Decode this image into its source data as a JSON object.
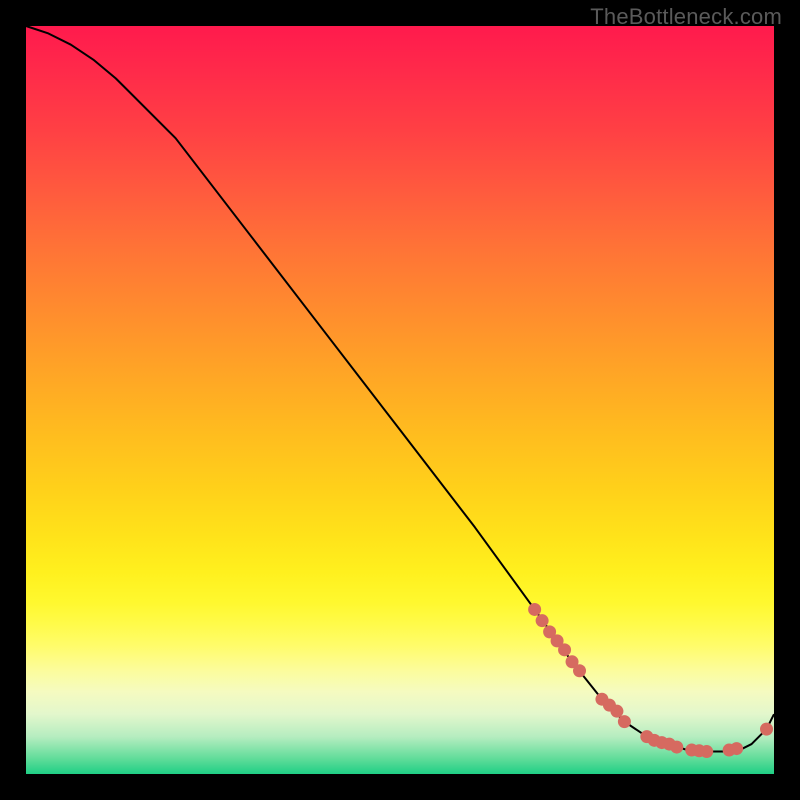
{
  "watermark": "TheBottleneck.com",
  "chart_data": {
    "type": "line",
    "title": "",
    "xlabel": "",
    "ylabel": "",
    "xlim": [
      0,
      100
    ],
    "ylim": [
      0,
      100
    ],
    "background_gradient": {
      "top_color": "#ff1a4d",
      "mid_color": "#ffd11a",
      "bottom_color": "#1fcf85"
    },
    "curve": {
      "x": [
        0,
        3,
        6,
        9,
        12,
        20,
        30,
        40,
        50,
        60,
        68,
        73,
        77,
        80,
        83,
        86,
        89,
        92,
        95,
        97,
        99,
        100
      ],
      "y": [
        100,
        99,
        97.5,
        95.5,
        93,
        85,
        72,
        59,
        46,
        33,
        22,
        15,
        10,
        7,
        5,
        4,
        3,
        3,
        3,
        4,
        6,
        8
      ]
    },
    "markers": {
      "x": [
        68,
        69,
        70,
        71,
        72,
        73,
        74,
        77,
        78,
        79,
        80,
        83,
        84,
        85,
        86,
        87,
        89,
        90,
        91,
        94,
        95,
        99
      ],
      "y": [
        22,
        20.5,
        19,
        17.8,
        16.6,
        15,
        13.8,
        10,
        9.2,
        8.4,
        7.0,
        5.0,
        4.5,
        4.2,
        4.0,
        3.6,
        3.2,
        3.1,
        3.0,
        3.2,
        3.4,
        6.0
      ]
    }
  }
}
